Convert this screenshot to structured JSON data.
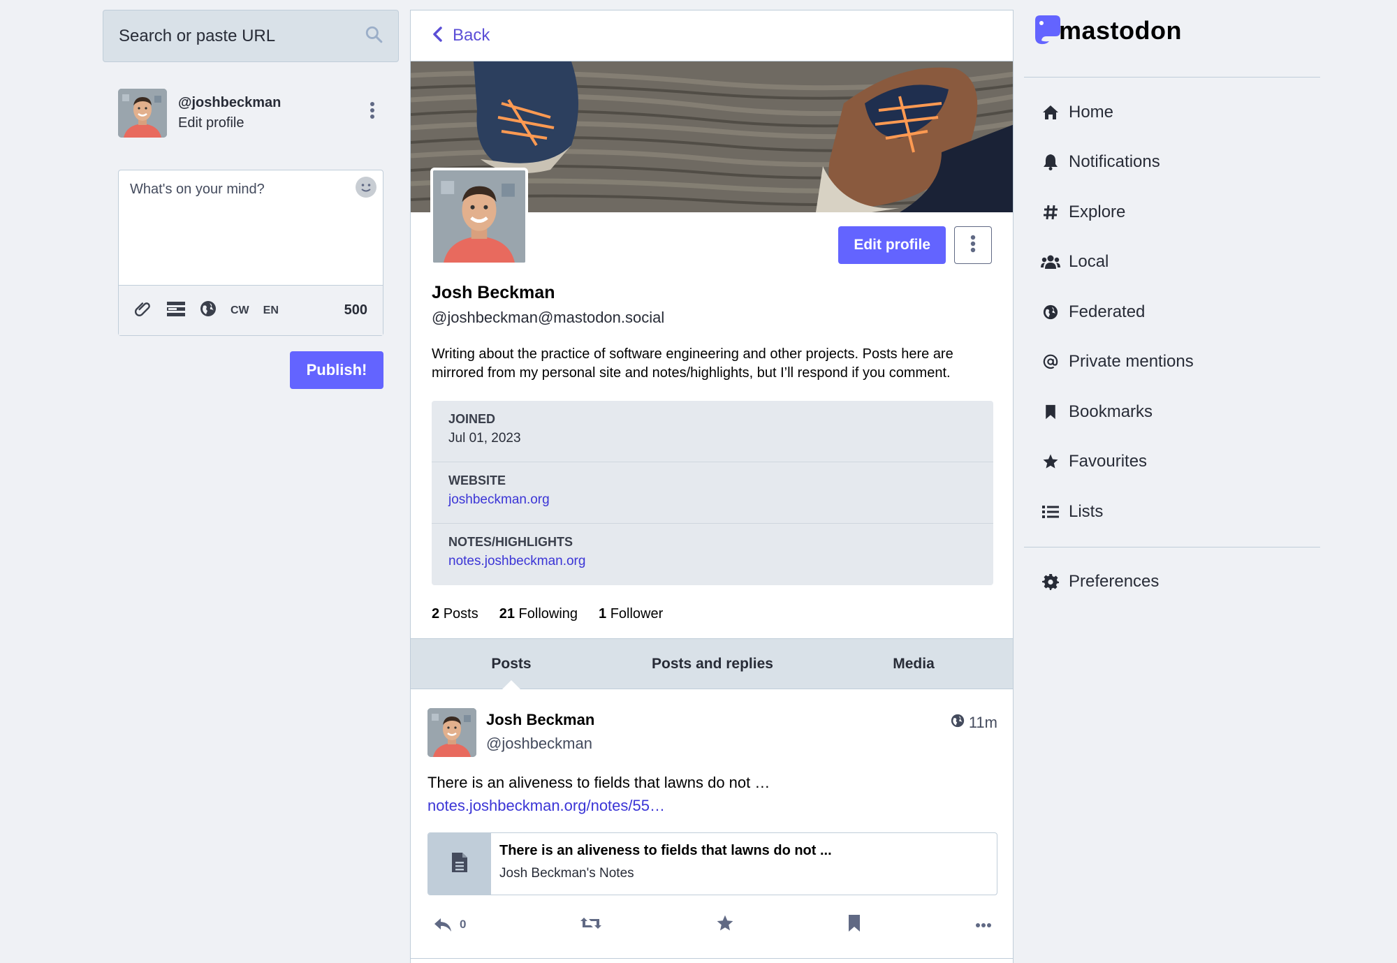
{
  "search": {
    "placeholder": "Search or paste URL"
  },
  "me": {
    "handle": "@joshbeckman",
    "edit_label": "Edit profile"
  },
  "composer": {
    "placeholder": "What's on your mind?",
    "cw_label": "CW",
    "lang_label": "EN",
    "char_count": "500",
    "publish_label": "Publish!"
  },
  "back": {
    "label": "Back"
  },
  "profile": {
    "display_name": "Josh Beckman",
    "acct": "@joshbeckman@mastodon.social",
    "edit_button": "Edit profile",
    "bio": "Writing about the practice of software engineering and other projects. Posts here are mirrored from my personal site and notes/highlights, but I’ll respond if you comment.",
    "fields": [
      {
        "name": "JOINED",
        "value": "Jul 01, 2023"
      },
      {
        "name": "WEBSITE",
        "value": "joshbeckman.org"
      },
      {
        "name": "NOTES/HIGHLIGHTS",
        "value": "notes.joshbeckman.org"
      }
    ],
    "counts": {
      "posts_num": "2",
      "posts_label": "Posts",
      "following_num": "21",
      "following_label": "Following",
      "followers_num": "1",
      "followers_label": "Follower"
    }
  },
  "tabs": [
    "Posts",
    "Posts and replies",
    "Media"
  ],
  "status": {
    "display_name": "Josh Beckman",
    "acct": "@joshbeckman",
    "time": "11m",
    "text": "There is an aliveness to fields that lawns do not …",
    "link": "notes.joshbeckman.org/notes/55…",
    "card_title": "There is an aliveness to fields that lawns do not ...",
    "card_provider": "Josh Beckman's Notes",
    "replies": "0"
  },
  "logo": {
    "word": "mastodon"
  },
  "nav": {
    "home": "Home",
    "notifications": "Notifications",
    "explore": "Explore",
    "local": "Local",
    "federated": "Federated",
    "private_mentions": "Private mentions",
    "bookmarks": "Bookmarks",
    "favourites": "Favourites",
    "lists": "Lists",
    "preferences": "Preferences"
  },
  "colors": {
    "accent": "#6364ff",
    "link": "#3b35d6",
    "background": "#eff1f5"
  }
}
